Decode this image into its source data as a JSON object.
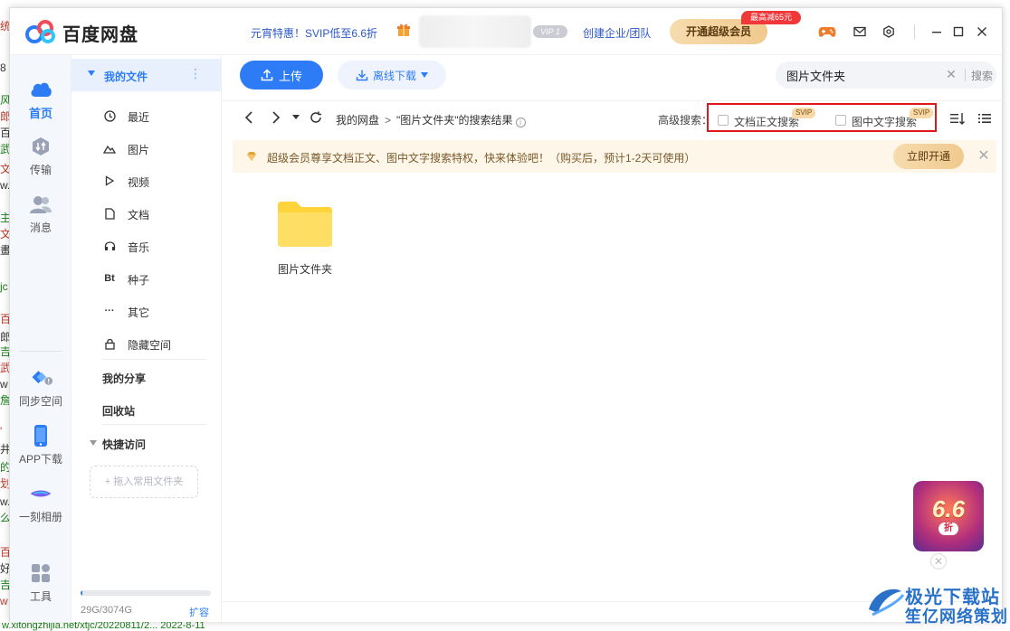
{
  "background": {
    "left_fragments": [
      "统",
      "8",
      "风",
      "郎",
      "百",
      "武",
      "文",
      "w.",
      "主",
      "文",
      "畫",
      "jc",
      "百",
      "郎",
      "吉",
      "武",
      "w",
      "詹",
      "'",
      "井",
      "的",
      "划",
      "w.",
      "么",
      "百",
      "好",
      "吉",
      "w"
    ],
    "footer_text": "w.xitongzhijia.net/xtjc/20220811/2...   2022-8-11"
  },
  "titlebar": {
    "app_name": "百度网盘",
    "promo": "元宵特惠！SVIP低至6.6折",
    "vip_badge": "VIP 1",
    "enterprise_link": "创建企业/团队",
    "svip_button": "开通超级会员",
    "svip_discount": "最高减65元"
  },
  "leftnav": {
    "home": "首页",
    "transfer": "传输",
    "messages": "消息",
    "sync": "同步空间",
    "app_download": "APP下载",
    "album": "一刻相册",
    "tools": "工具"
  },
  "sidebar": {
    "my_files": "我的文件",
    "items": [
      {
        "label": "最近",
        "icon": "clock-icon"
      },
      {
        "label": "图片",
        "icon": "image-icon"
      },
      {
        "label": "视频",
        "icon": "play-icon"
      },
      {
        "label": "文档",
        "icon": "document-icon"
      },
      {
        "label": "音乐",
        "icon": "headphones-icon"
      },
      {
        "label": "种子",
        "icon": "bt-icon",
        "glyph": "Bt"
      },
      {
        "label": "其它",
        "icon": "more-icon",
        "glyph": "···"
      },
      {
        "label": "隐藏空间",
        "icon": "lock-icon"
      }
    ],
    "my_share": "我的分享",
    "recycle_bin": "回收站",
    "quick_access": "快捷访问",
    "drag_folder": "+ 拖入常用文件夹",
    "storage_text": "29G/3074G",
    "storage_used_fraction": 0.0094,
    "expand": "扩容"
  },
  "toolbar": {
    "upload": "上传",
    "offline_download": "离线下载",
    "search_value": "图片文件夹",
    "search_button": "搜索"
  },
  "navrow": {
    "breadcrumb_root": "我的网盘",
    "breadcrumb_sep": ">",
    "breadcrumb_current": "\"图片文件夹\"的搜索结果",
    "advanced_label": "高级搜索：",
    "option_fulltext": "文档正文搜索",
    "option_ocr": "图中文字搜索",
    "svip_tag": "SVIP"
  },
  "banner": {
    "text": "超级会员尊享文档正文、图中文字搜索特权，快来体验吧！（购买后，预计1-2天可使用）",
    "button": "立即开通"
  },
  "results": [
    {
      "name": "图片文件夹",
      "type": "folder"
    }
  ],
  "float_promo": {
    "number": "6.6",
    "unit": "折"
  },
  "watermark": {
    "line1": "极光下载站",
    "line2": "笙亿网络策划"
  },
  "colors": {
    "accent": "#2d7cf5",
    "highlight_box": "#e0181b",
    "folder": "#ffd43b",
    "banner_bg": "#fdf6e9"
  }
}
